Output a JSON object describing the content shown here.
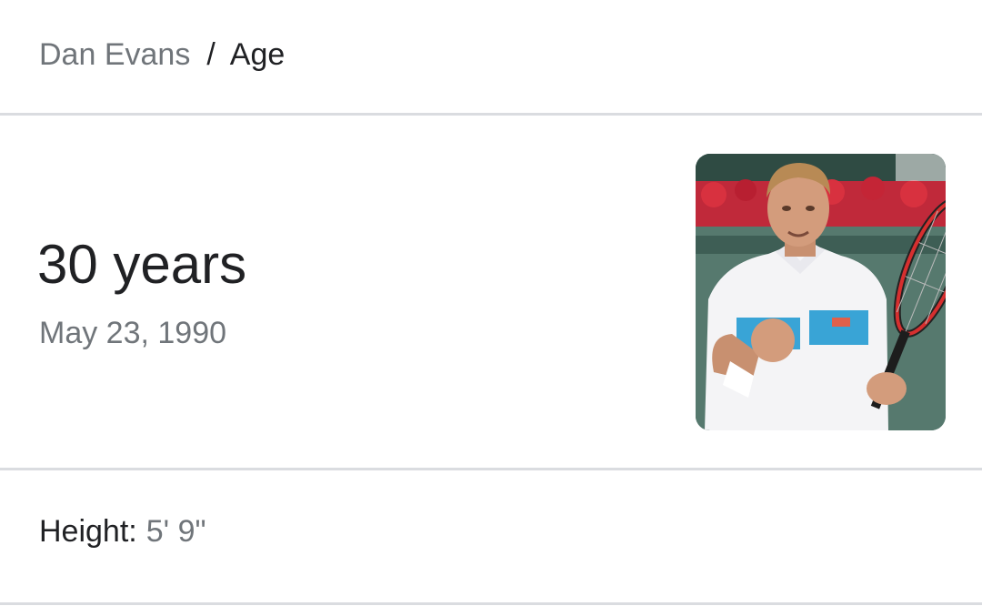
{
  "breadcrumb": {
    "parent": "Dan Evans",
    "separator": "/",
    "current": "Age"
  },
  "answer": {
    "value": "30 years",
    "detail": "May 23, 1990"
  },
  "image": {
    "subject_icon": "tennis-player-photo"
  },
  "facts": [
    {
      "label": "Height:",
      "value": "5' 9\""
    }
  ],
  "colors": {
    "text_primary": "#202124",
    "text_secondary": "#70757a",
    "divider": "#dadce0"
  }
}
